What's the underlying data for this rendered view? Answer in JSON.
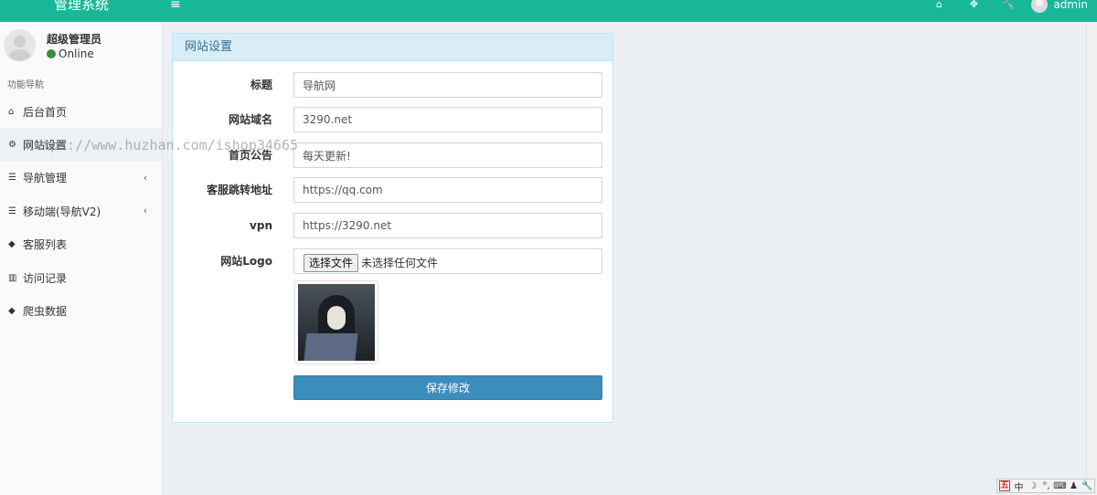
{
  "app": {
    "title": "管理系统",
    "menu_toggle": "≡"
  },
  "topbar": {
    "icons": [
      "home-icon",
      "fullscreen-icon",
      "wrench-icon"
    ],
    "user_name": "admin"
  },
  "sidebar": {
    "profile_name": "超级管理员",
    "profile_status": "Online",
    "nav_header": "功能导航",
    "items": [
      {
        "icon": "home-icon",
        "glyph": "⌂",
        "label": "后台首页",
        "has_children": false
      },
      {
        "icon": "cogs-icon",
        "glyph": "⚙",
        "label": "网站设置",
        "has_children": false,
        "active": true
      },
      {
        "icon": "database-icon",
        "glyph": "☰",
        "label": "导航管理",
        "has_children": true
      },
      {
        "icon": "database-icon",
        "glyph": "☰",
        "label": "移动端(导航V2)",
        "has_children": true
      },
      {
        "icon": "tags-icon",
        "glyph": "◆",
        "label": "客服列表",
        "has_children": false
      },
      {
        "icon": "bar-chart-icon",
        "glyph": "▥",
        "label": "访问记录",
        "has_children": false
      },
      {
        "icon": "tags-icon",
        "glyph": "◆",
        "label": "爬虫数据",
        "has_children": false
      }
    ],
    "chevron": "‹"
  },
  "watermark": "https://www.huzhan.com/ishop34665",
  "panel": {
    "title": "网站设置",
    "fields": [
      {
        "label": "标题",
        "value": "导航网"
      },
      {
        "label": "网站域名",
        "value": "3290.net"
      },
      {
        "label": "首页公告",
        "value": "每天更新!"
      },
      {
        "label": "客服跳转地址",
        "value": "https://qq.com"
      },
      {
        "label": "vpn",
        "value": "https://3290.net"
      }
    ],
    "logo_label": "网站Logo",
    "file_button": "选择文件",
    "file_status": "未选择任何文件",
    "save_label": "保存修改"
  },
  "ime": {
    "items": [
      "五",
      "中",
      "☽",
      "°,",
      "⌨",
      "♟",
      "🔧"
    ]
  },
  "colors": {
    "topbar": "#18b797",
    "panel_header": "#d9edf7",
    "panel_title": "#31708f",
    "primary_button": "#3c8dbc",
    "online": "#3c8d3c"
  }
}
